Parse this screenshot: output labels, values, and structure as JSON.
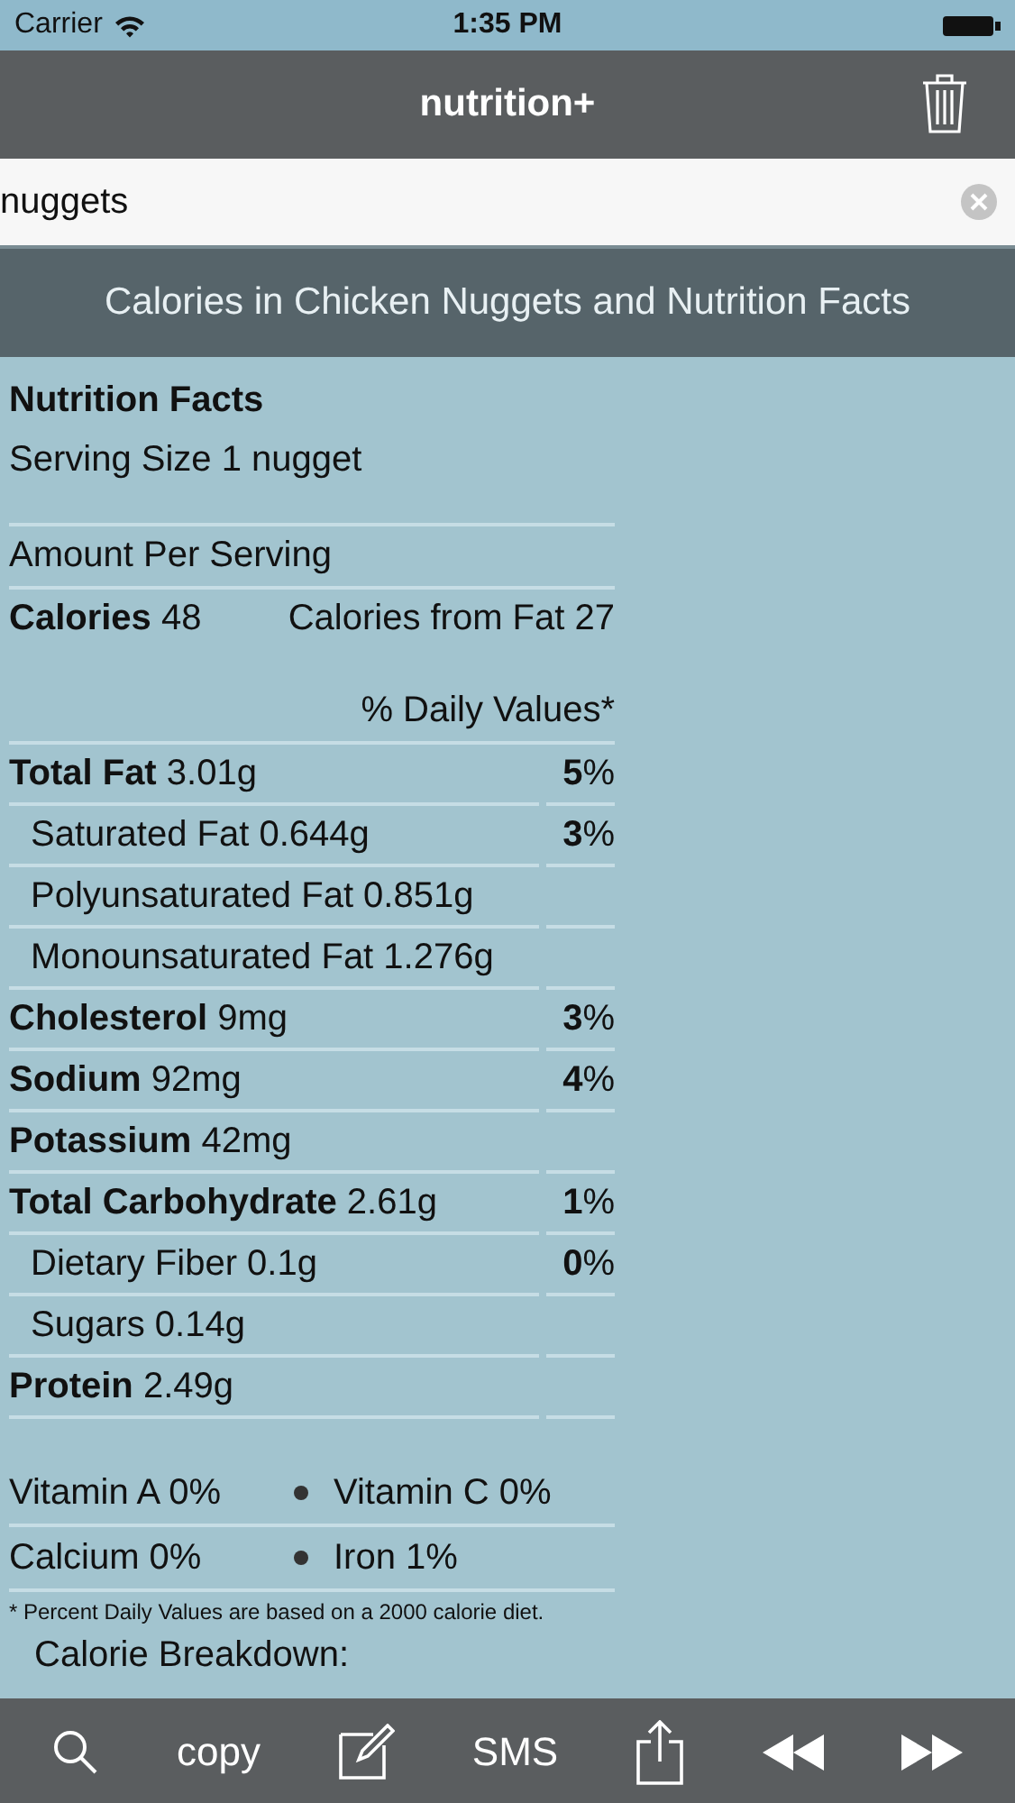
{
  "status_bar": {
    "carrier": "Carrier",
    "time": "1:35 PM"
  },
  "nav_bar": {
    "title": "nutrition+"
  },
  "search": {
    "value": "nuggets"
  },
  "heading": "Calories in Chicken Nuggets and Nutrition Facts",
  "facts": {
    "title": "Nutrition Facts",
    "serving": "Serving Size 1 nugget",
    "amount_per_serving": "Amount Per Serving",
    "calories": "**Calories** 48",
    "calories_from_fat": "Calories from Fat 27",
    "daily_values_header": "% Daily Values*",
    "rows": [
      {
        "kind": "main",
        "label": "**Total Fat** 3.01g",
        "dv": "**5**%"
      },
      {
        "kind": "sub",
        "label": "Saturated Fat 0.644g",
        "dv": "**3**%"
      },
      {
        "kind": "sub",
        "label": "Polyunsaturated Fat 0.851g"
      },
      {
        "kind": "sub",
        "label": "Monounsaturated Fat 1.276g"
      },
      {
        "kind": "main",
        "label": "**Cholesterol** 9mg",
        "dv": "**3**%"
      },
      {
        "kind": "main",
        "label": "**Sodium** 92mg",
        "dv": "**4**%"
      },
      {
        "kind": "main",
        "label": "**Potassium** 42mg"
      },
      {
        "kind": "main",
        "label": "**Total Carbohydrate** 2.61g",
        "dv": "**1**%"
      },
      {
        "kind": "sub",
        "label": "Dietary Fiber 0.1g",
        "dv": "**0**%"
      },
      {
        "kind": "sub",
        "label": "Sugars 0.14g"
      },
      {
        "kind": "main",
        "label": "**Protein** 2.49g"
      }
    ],
    "vitamins": [
      [
        "Vitamin A 0%",
        "Vitamin C 0%"
      ],
      [
        "Calcium 0%",
        "Iron 1%"
      ]
    ],
    "footnote": "* Percent Daily Values are based on a 2000 calorie diet.",
    "breakdown_title": "Calorie Breakdown:"
  },
  "toolbar": [
    "copy",
    "SMS"
  ]
}
